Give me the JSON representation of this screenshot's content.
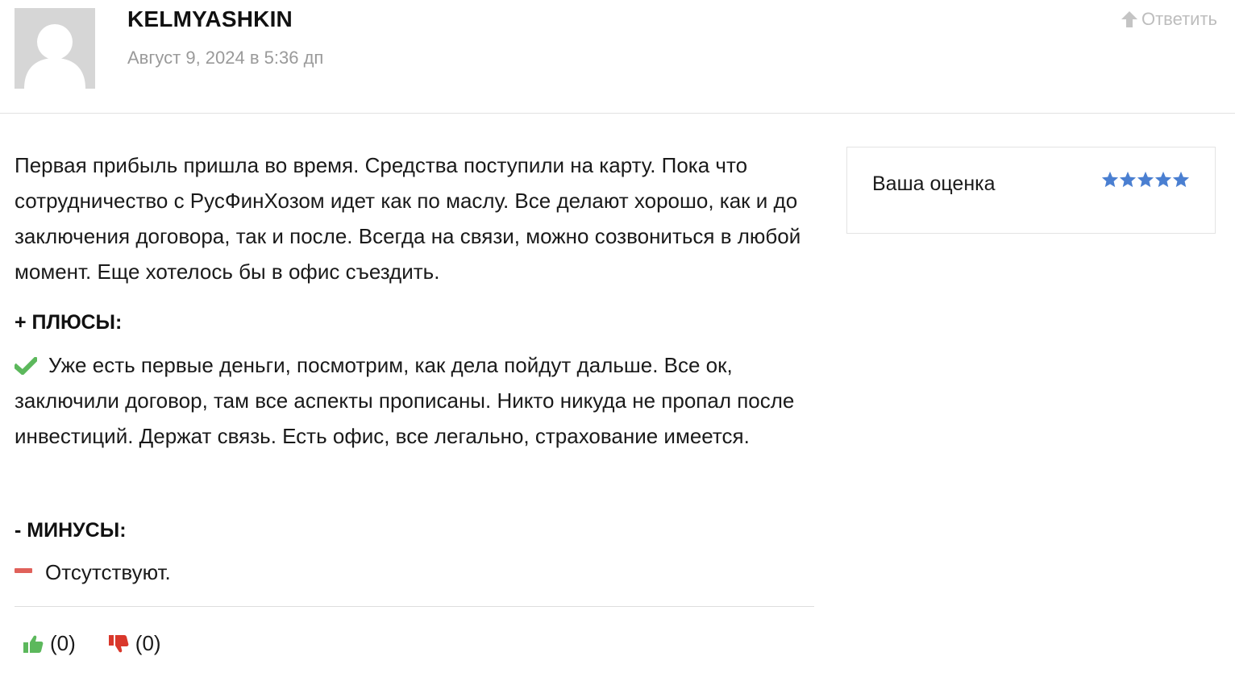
{
  "comment": {
    "author": "KELMYASHKIN",
    "date": "Август 9, 2024 в 5:36 дп",
    "reply_label": "Ответить",
    "body": "Первая прибыль пришла во время. Средства поступили на карту. Пока что сотрудничество с РусФинХозом идет как по маслу. Все делают хорошо, как и до заключения договора, так и после. Всегда на связи, можно созвониться в любой момент. Еще хотелось бы в офис съездить.",
    "pros_title": "+ ПЛЮСЫ:",
    "pros_text": "Уже есть первые деньги, посмотрим, как дела пойдут дальше. Все ок, заключили договор, там все аспекты прописаны. Никто никуда не пропал после инвестиций. Держат связь. Есть офис, все легально, страхование имеется.",
    "cons_title": "- МИНУСЫ:",
    "cons_text": "Отсутствуют.",
    "likes": "(0)",
    "dislikes": "(0)"
  },
  "rating": {
    "label": "Ваша оценка",
    "stars_filled": 5,
    "stars_total": 5
  },
  "colors": {
    "star": "#4a7fd1",
    "check": "#5cb85c",
    "minus": "#e0615a",
    "thumb_up": "#5cb85c",
    "thumb_down": "#d9372b",
    "muted_text": "#9a9a9a"
  },
  "icons": {
    "avatar": "default-user-avatar",
    "reply": "arrow-up-icon",
    "pros": "check-icon",
    "cons": "minus-icon",
    "like": "thumbs-up-icon",
    "dislike": "thumbs-down-icon",
    "rating": "star-icon"
  }
}
